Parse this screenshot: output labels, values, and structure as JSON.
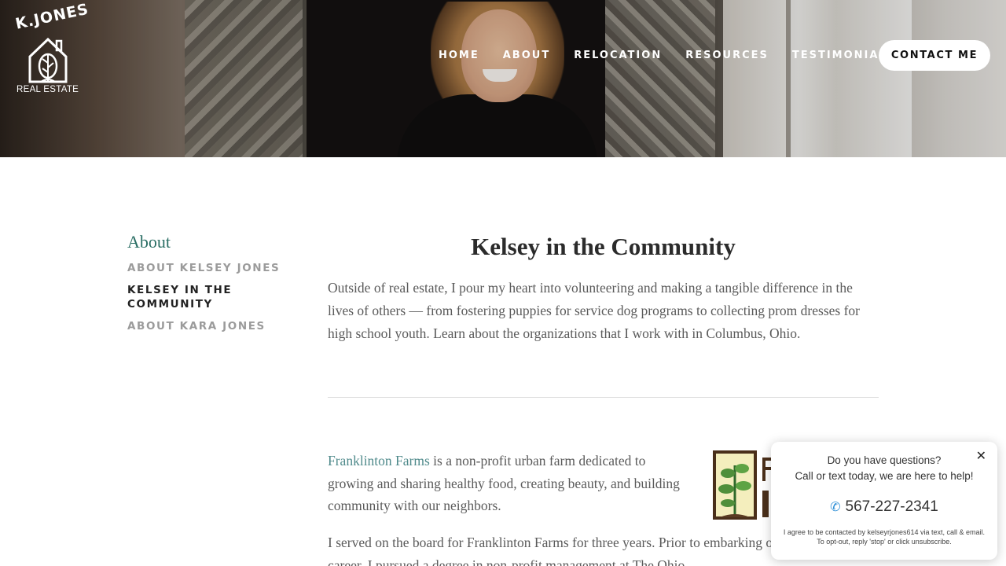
{
  "logo": {
    "top_text": "K.JONES",
    "bottom_text": "REAL ESTATE"
  },
  "nav": {
    "items": [
      "HOME",
      "ABOUT",
      "RELOCATION",
      "RESOURCES",
      "TESTIMONIALS"
    ],
    "contact_label": "CONTACT ME"
  },
  "sidebar": {
    "heading": "About",
    "items": [
      {
        "label": "ABOUT KELSEY JONES",
        "active": false
      },
      {
        "label": "KELSEY IN THE COMMUNITY",
        "active": true
      },
      {
        "label": "ABOUT KARA JONES",
        "active": false
      }
    ]
  },
  "main": {
    "title": "Kelsey in the Community",
    "intro": "Outside of real estate, I pour my heart into volunteering and making a tangible difference in the lives of others — from fostering puppies for service dog programs to collecting prom dresses for high school youth. Learn about the organizations that I work with in Columbus, Ohio.",
    "org": {
      "link": "Franklinton Farms",
      "desc": " is a non-profit urban farm dedicated to growing and sharing healthy food, creating beauty, and building community with our neighbors.",
      "para2": "I served on the board for Franklinton Farms for three years. Prior to embarking on my real estate career, I pursued a degree in non-profit management at The Ohio"
    }
  },
  "chat": {
    "line1": "Do you have questions?",
    "line2": "Call or text today, we are here to help!",
    "phone": "567-227-2341",
    "fine_print": "I agree to be contacted by kelseyrjones614 via text, call & email. To opt-out, reply 'stop' or click unsubscribe.",
    "close": "✕"
  },
  "colors": {
    "accent": "#2a6e64",
    "link": "#4f8a8b",
    "phone_icon": "#2f8fd6"
  },
  "icons": {
    "phone": "phone-icon",
    "close": "close-icon",
    "logo_house": "house-leaf-icon"
  }
}
